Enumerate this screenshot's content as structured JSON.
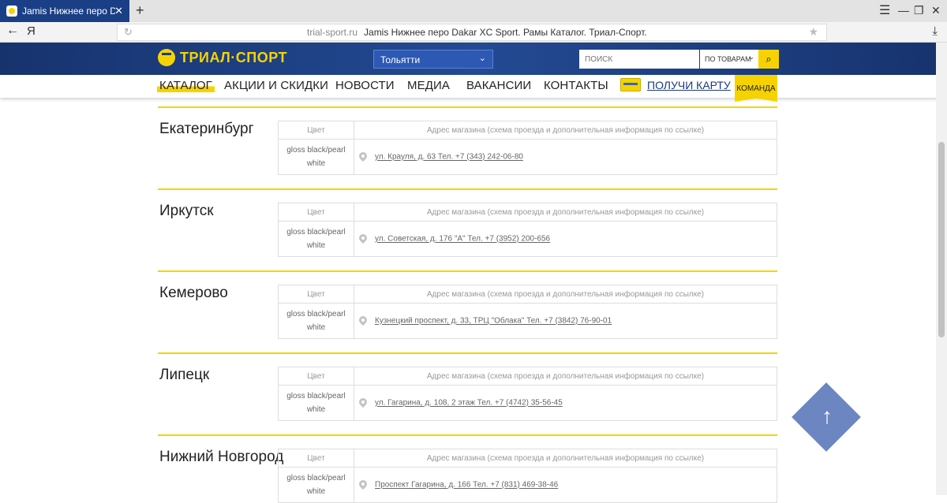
{
  "browser": {
    "tab_title": "Jamis Нижнее перо Dakar XC Sport. Рамы Каталог. Триал-Спорт.",
    "new_tab_label": "+",
    "back_label": "←",
    "yandex_label": "Я",
    "url_domain": "trial-sport.ru",
    "page_title": "Jamis Нижнее перо Dakar XC Sport. Рамы Каталог. Триал-Спорт.",
    "icons": [
      "menu-icon",
      "minimize-icon",
      "maximize-icon",
      "close-icon",
      "reload-icon",
      "star-icon",
      "download-icon"
    ]
  },
  "header": {
    "logo_text": "ТРИАЛ·СПОРТ",
    "city_selected": "Тольятти",
    "search_placeholder": "ПОИСК",
    "search_scope": "ПО ТОВАРАМ"
  },
  "nav": {
    "items": [
      "КАТАЛОГ",
      "АКЦИИ И СКИДКИ",
      "НОВОСТИ",
      "МЕДИА",
      "ВАКАНСИИ",
      "КОНТАКТЫ"
    ],
    "card_label": "ПОЛУЧИ КАРТУ",
    "team_label": "КОМАНДА"
  },
  "stores": {
    "header_color": "Цвет",
    "header_address": "Адрес магазина (схема проезда и дополнительная информация по ссылке)",
    "rows": [
      {
        "city": "Екатеринбург",
        "color": "gloss black/pearl white",
        "address": "ул. Крауля, д. 63 Тел. +7 (343) 242-06-80"
      },
      {
        "city": "Иркутск",
        "color": "gloss black/pearl white",
        "address": "ул. Советская, д. 176 \"А\" Тел. +7 (3952) 200-656"
      },
      {
        "city": "Кемерово",
        "color": "gloss black/pearl white",
        "address": "Кузнецкий проспект, д. 33, ТРЦ \"Облака\" Тел. +7 (3842) 76-90-01"
      },
      {
        "city": "Липецк",
        "color": "gloss black/pearl white",
        "address": "ул. Гагарина, д. 108, 2 этаж Тел. +7 (4742) 35-56-45"
      },
      {
        "city": "Нижний Новгород",
        "color": "gloss black/pearl white",
        "address": "Проспект Гагарина, д. 166 Тел. +7 (831) 469-38-46"
      }
    ]
  },
  "colors": {
    "brand_yellow": "#f6d300",
    "brand_blue": "#1b3b7d",
    "scroll_top": "#6b86c0"
  }
}
